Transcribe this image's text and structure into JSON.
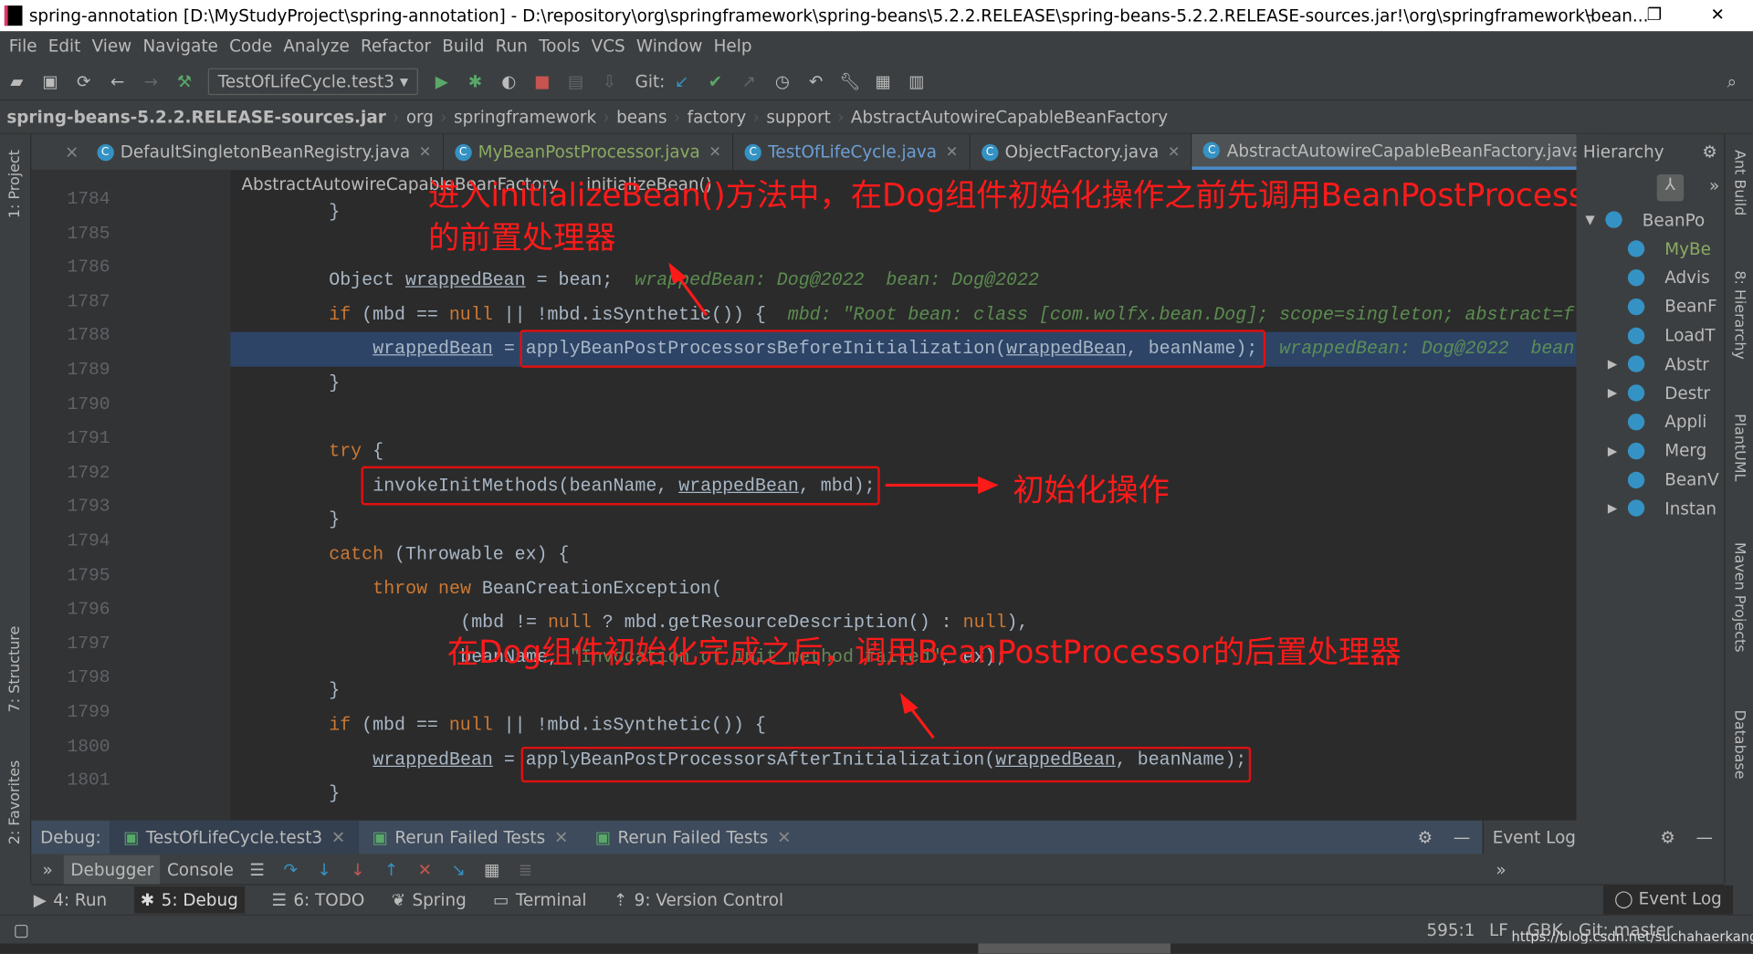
{
  "window": {
    "title": "spring-annotation [D:\\MyStudyProject\\spring-annotation] - D:\\repository\\org\\springframework\\spring-beans\\5.2.2.RELEASE\\spring-beans-5.2.2.RELEASE-sources.jar!\\org\\springframework\\bean...",
    "minimize": "–",
    "restore": "❐",
    "close": "✕"
  },
  "menu": [
    "File",
    "Edit",
    "View",
    "Navigate",
    "Code",
    "Analyze",
    "Refactor",
    "Build",
    "Run",
    "Tools",
    "VCS",
    "Window",
    "Help"
  ],
  "toolbar": {
    "run_config": "TestOfLifeCycle.test3",
    "git_label": "Git:"
  },
  "nav": [
    "spring-beans-5.2.2.RELEASE-sources.jar",
    "org",
    "springframework",
    "beans",
    "factory",
    "support",
    "AbstractAutowireCapableBeanFactory"
  ],
  "tabs": [
    {
      "label": "DefaultSingletonBeanRegistry.java",
      "color": "#bbbbbb",
      "active": false
    },
    {
      "label": "MyBeanPostProcessor.java",
      "color": "#8aab62",
      "active": false
    },
    {
      "label": "TestOfLifeCycle.java",
      "color": "#6c9fd6",
      "active": false
    },
    {
      "label": "ObjectFactory.java",
      "color": "#bbbbbb",
      "active": false
    },
    {
      "label": "AbstractAutowireCapableBeanFactory.java",
      "color": "#bbbbbb",
      "active": true
    }
  ],
  "tabs_overflow": "≡5",
  "breadcrumb": {
    "class": "AbstractAutowireCapableBeanFactory",
    "method": "initializeBean()"
  },
  "code": {
    "lines": [
      {
        "n": "1784",
        "indent": 9,
        "t": [
          [
            "p",
            "}"
          ]
        ]
      },
      {
        "n": "1785",
        "indent": 9,
        "t": []
      },
      {
        "n": "1786",
        "indent": 9,
        "t": [
          [
            "p",
            "Object "
          ],
          [
            "u",
            "wrappedBean"
          ],
          [
            "p",
            " = bean;  "
          ],
          [
            "h",
            "wrappedBean: Dog@2022  bean: Dog@2022"
          ]
        ]
      },
      {
        "n": "1787",
        "indent": 9,
        "t": [
          [
            "k",
            "if"
          ],
          [
            "p",
            " (mbd == "
          ],
          [
            "k",
            "null"
          ],
          [
            "p",
            " || !mbd.isSynthetic()) {  "
          ],
          [
            "h",
            "mbd: \"Root bean: class [com.wolfx.bean.Dog]; scope=singleton; abstract=f"
          ]
        ]
      },
      {
        "n": "1788",
        "indent": 13,
        "hl": true,
        "t": [
          [
            "u",
            "wrappedBean"
          ],
          [
            "p",
            " = applyBeanPostProcessorsBeforeInitialization("
          ],
          [
            "u",
            "wrappedBean"
          ],
          [
            "p",
            ", beanName);  "
          ],
          [
            "h",
            "wrappedBean: Dog@2022  bean"
          ]
        ]
      },
      {
        "n": "1789",
        "indent": 9,
        "t": [
          [
            "p",
            "}"
          ]
        ]
      },
      {
        "n": "1790",
        "indent": 9,
        "t": []
      },
      {
        "n": "1791",
        "indent": 9,
        "t": [
          [
            "k",
            "try"
          ],
          [
            "p",
            " {"
          ]
        ]
      },
      {
        "n": "1792",
        "indent": 13,
        "t": [
          [
            "p",
            "invokeInitMethods(beanName, "
          ],
          [
            "u",
            "wrappedBean"
          ],
          [
            "p",
            ", mbd);"
          ]
        ]
      },
      {
        "n": "1793",
        "indent": 9,
        "t": [
          [
            "p",
            "}"
          ]
        ]
      },
      {
        "n": "1794",
        "indent": 9,
        "t": [
          [
            "k",
            "catch"
          ],
          [
            "p",
            " (Throwable ex) {"
          ]
        ]
      },
      {
        "n": "1795",
        "indent": 13,
        "t": [
          [
            "k",
            "throw new"
          ],
          [
            "p",
            " BeanCreationException("
          ]
        ]
      },
      {
        "n": "1796",
        "indent": 21,
        "t": [
          [
            "p",
            "(mbd != "
          ],
          [
            "k",
            "null"
          ],
          [
            "p",
            " ? mbd.getResourceDescription() : "
          ],
          [
            "k",
            "null"
          ],
          [
            "p",
            "),"
          ]
        ]
      },
      {
        "n": "1797",
        "indent": 21,
        "t": [
          [
            "p",
            "beanName, "
          ],
          [
            "s",
            "\"Invocation of init method failed\""
          ],
          [
            "p",
            ", ex);"
          ]
        ]
      },
      {
        "n": "1798",
        "indent": 9,
        "t": [
          [
            "p",
            "}"
          ]
        ]
      },
      {
        "n": "1799",
        "indent": 9,
        "t": [
          [
            "k",
            "if"
          ],
          [
            "p",
            " (mbd == "
          ],
          [
            "k",
            "null"
          ],
          [
            "p",
            " || !mbd.isSynthetic()) {"
          ]
        ]
      },
      {
        "n": "1800",
        "indent": 13,
        "t": [
          [
            "u",
            "wrappedBean"
          ],
          [
            "p",
            " = applyBeanPostProcessorsAfterInitialization("
          ],
          [
            "u",
            "wrappedBean"
          ],
          [
            "p",
            ", beanName);"
          ]
        ]
      },
      {
        "n": "1801",
        "indent": 9,
        "t": [
          [
            "p",
            "}"
          ]
        ]
      }
    ]
  },
  "annotations": {
    "before": "进入initializeBean()方法中，在Dog组件初始化操作之前先调用BeanPostProcessor",
    "before2": "的前置处理器",
    "init": "初始化操作",
    "after": "在Dog组件初始化完成之后，调用BeanPostProcessor的后置处理器",
    "color": "#ff1a1a"
  },
  "hierarchy": {
    "title": "Hierarchy",
    "items": [
      {
        "label": "BeanPo",
        "arrow": "▼",
        "color": "#bbbbbb"
      },
      {
        "label": "MyBe",
        "arrow": "",
        "color": "#8aab62"
      },
      {
        "label": "Advis",
        "arrow": "",
        "color": "#bbbbbb"
      },
      {
        "label": "BeanF",
        "arrow": "",
        "color": "#bbbbbb"
      },
      {
        "label": "LoadT",
        "arrow": "",
        "color": "#bbbbbb"
      },
      {
        "label": "Abstr",
        "arrow": "▶",
        "color": "#bbbbbb"
      },
      {
        "label": "Destr",
        "arrow": "▶",
        "color": "#bbbbbb"
      },
      {
        "label": "Appli",
        "arrow": "",
        "color": "#bbbbbb"
      },
      {
        "label": "Merg",
        "arrow": "▶",
        "color": "#bbbbbb"
      },
      {
        "label": "BeanV",
        "arrow": "",
        "color": "#bbbbbb"
      },
      {
        "label": "Instan",
        "arrow": "▶",
        "color": "#bbbbbb"
      }
    ]
  },
  "right_strip": [
    "Ant Build",
    "8: Hierarchy",
    "PlantUML",
    "Maven Projects",
    "Database"
  ],
  "left_strip": [
    "1: Project",
    "7: Structure",
    "2: Favorites"
  ],
  "debug": {
    "label": "Debug:",
    "tabs": [
      "TestOfLifeCycle.test3",
      "Rerun Failed Tests",
      "Rerun Failed Tests"
    ],
    "subtabs": [
      "Debugger",
      "Console"
    ]
  },
  "event_log": {
    "title": "Event Log"
  },
  "bottom_tools": [
    "4: Run",
    "5: Debug",
    "6: TODO",
    "Spring",
    "Terminal",
    "9: Version Control"
  ],
  "bottom_event_log": "Event Log",
  "status": {
    "position": "595:1",
    "line_sep": "LF",
    "encoding": "GBK",
    "git": "Git: master",
    "watermark": "https://blog.csdn.net/suchahaerkang"
  }
}
